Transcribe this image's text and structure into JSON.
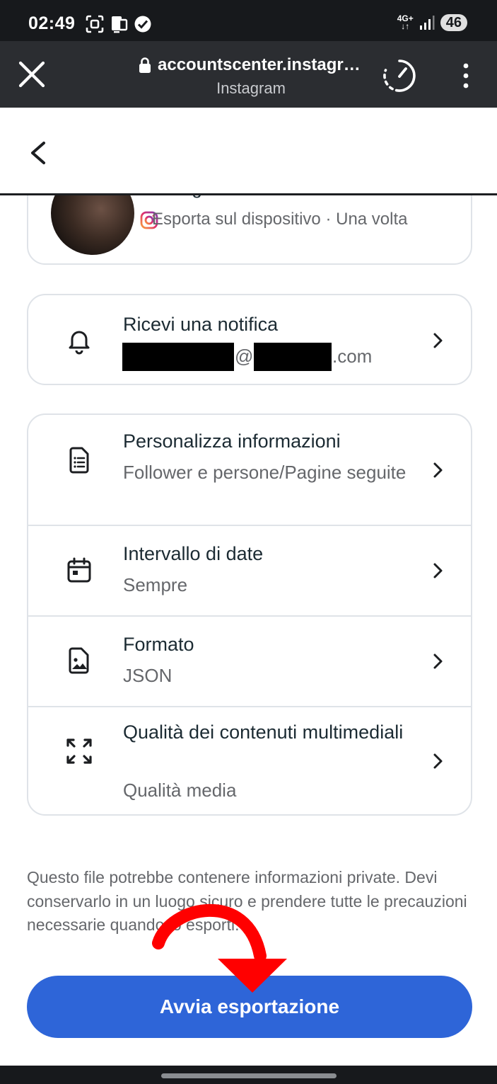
{
  "status_bar": {
    "time": "02:49",
    "network": "4G+",
    "battery": "46"
  },
  "browser": {
    "url": "accountscenter.instagra...",
    "site_name": "Instagram"
  },
  "account_card": {
    "name": "Instagram",
    "subtitle": "Esporta sul dispositivo · Una volta"
  },
  "notify": {
    "title": "Ricevi una notifica",
    "email_at": "@",
    "email_suffix": ".com"
  },
  "options": [
    {
      "title": "Personalizza informazioni",
      "value": "Follower e persone/Pagine seguite",
      "icon": "document-list-icon"
    },
    {
      "title": "Intervallo di date",
      "value": "Sempre",
      "icon": "calendar-icon"
    },
    {
      "title": "Formato",
      "value": "JSON",
      "icon": "file-image-icon"
    },
    {
      "title": "Qualità dei contenuti multimediali",
      "value": "Qualità media",
      "icon": "expand-arrows-icon"
    }
  ],
  "disclaimer": "Questo file potrebbe contenere informazioni private. Devi conservarlo in un luogo sicuro e prendere tutte le precauzioni necessarie quando lo esporti.",
  "export_button": "Avvia esportazione",
  "colors": {
    "primary": "#2e65d8",
    "annotation_arrow": "#ff0000"
  }
}
